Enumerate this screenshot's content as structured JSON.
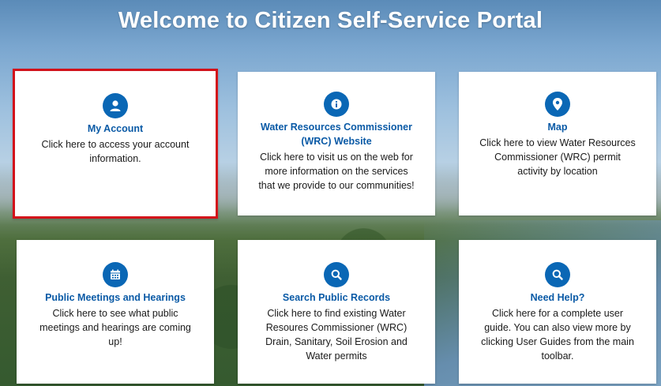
{
  "page": {
    "title": "Welcome to Citizen Self-Service Portal"
  },
  "colors": {
    "accent": "#0a67b5",
    "title_link": "#0a5aa6",
    "selection_outline": "#d3121a"
  },
  "cards": [
    {
      "icon": "user-icon",
      "title": "My Account",
      "desc": "Click here to access your account information.",
      "selected": true
    },
    {
      "icon": "info-icon",
      "title": "Water Resources Commissioner (WRC) Website",
      "desc": "Click here to visit us on the web for more information on the services that we provide to our communities!",
      "selected": false
    },
    {
      "icon": "map-pin-icon",
      "title": "Map",
      "desc": "Click here to view Water Resources Commissioner (WRC) permit activity by location",
      "selected": false
    },
    {
      "icon": "calendar-icon",
      "title": "Public Meetings and Hearings",
      "desc": "Click here to see what public meetings and hearings are coming up!",
      "selected": false
    },
    {
      "icon": "search-icon",
      "title": "Search Public Records",
      "desc": "Click here to find existing Water Resoures Commissioner (WRC) Drain, Sanitary, Soil Erosion and Water permits",
      "selected": false
    },
    {
      "icon": "search-icon",
      "title": "Need Help?",
      "desc": "Click here for a complete user guide. You can also view more by clicking User Guides from the main toolbar.",
      "selected": false
    }
  ]
}
